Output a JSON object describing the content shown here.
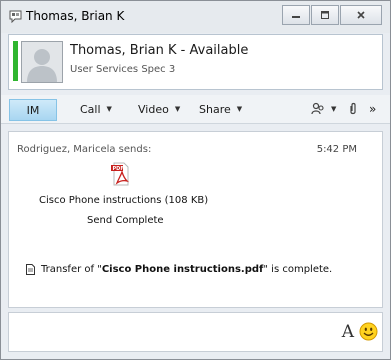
{
  "window": {
    "title": "Thomas, Brian K"
  },
  "contact": {
    "name_status": "Thomas, Brian K - Available",
    "subtitle": "User Services Spec 3",
    "presence_color": "#2fb52f"
  },
  "toolbar": {
    "im": "IM",
    "call": "Call",
    "video": "Video",
    "share": "Share"
  },
  "conversation": {
    "sender": "Rodriguez, Maricela sends:",
    "time": "5:42 PM",
    "file_name": "Cisco Phone instructions (108 KB)",
    "file_status": "Send Complete",
    "notice_prefix": "Transfer of \"",
    "notice_file": "Cisco Phone instructions.pdf",
    "notice_suffix": "\" is complete."
  },
  "compose": {
    "font_label": "A"
  },
  "colors": {
    "accent": "#a8d6f1",
    "window_bg": "#e9edf2"
  }
}
